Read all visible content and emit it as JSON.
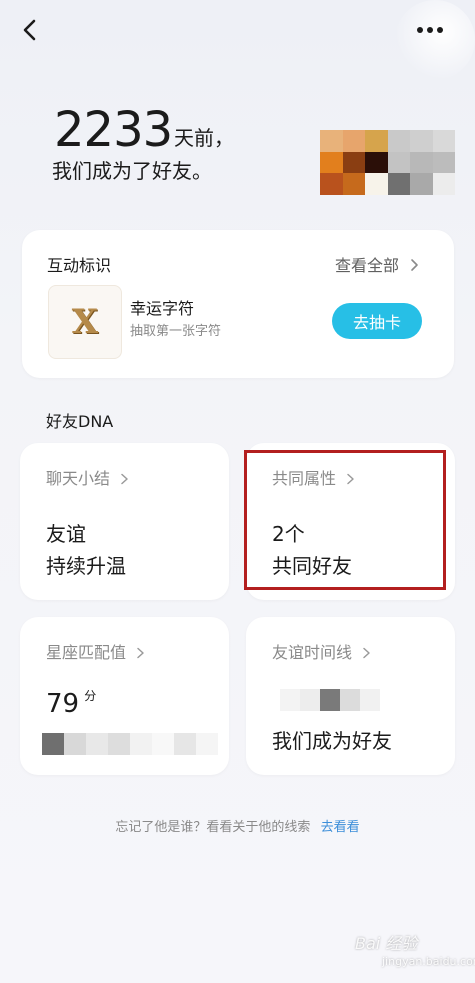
{
  "header": {
    "days": "2233",
    "days_unit": "天前，",
    "became_text": "我们成为了好友。"
  },
  "interaction": {
    "title": "互动标识",
    "view_all": "查看全部",
    "badge_letter": "X",
    "badge_name": "幸运字符",
    "badge_desc": "抽取第一张字符",
    "draw_button": "去抽卡"
  },
  "dna": {
    "section_title": "好友DNA",
    "chat_summary": {
      "title": "聊天小结",
      "line1": "友谊",
      "line2": "持续升温"
    },
    "common": {
      "title": "共同属性",
      "line1": "2个",
      "line2": "共同好友"
    },
    "zodiac": {
      "title": "星座匹配值",
      "score": "79",
      "score_unit": "分"
    },
    "timeline": {
      "title": "友谊时间线",
      "text": "我们成为好友"
    }
  },
  "footer": {
    "hint": "忘记了他是谁？看看关于他的线索",
    "link": "去看看"
  },
  "watermark": {
    "text": "Bai 经验",
    "sub": "jingyan.baidu.com"
  },
  "colors": {
    "accent_button": "#27bfe6",
    "link": "#3d8fd9",
    "highlight_border": "#b31f1f",
    "badge_gold": "#b58a4a"
  },
  "icons": {
    "back": "back-chevron-icon",
    "more": "more-dots-icon",
    "chevron": "chevron-right-icon"
  }
}
